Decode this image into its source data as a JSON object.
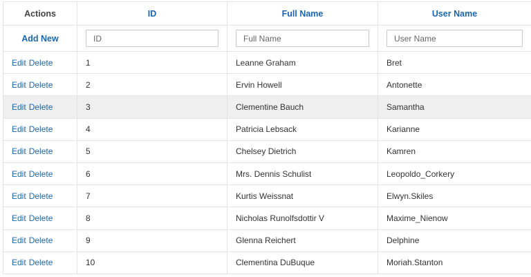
{
  "columns": {
    "actions": "Actions",
    "id": "ID",
    "full_name": "Full Name",
    "user_name": "User Name"
  },
  "filter": {
    "add_new_label": "Add New",
    "id_placeholder": "ID",
    "full_name_placeholder": "Full Name",
    "user_name_placeholder": "User Name"
  },
  "row_actions": {
    "edit_label": "Edit",
    "delete_label": "Delete"
  },
  "colors": {
    "link": "#1a66b3",
    "highlight_row": "#efefef",
    "border": "#e3e3e3"
  },
  "highlighted_row_index": 2,
  "rows": [
    {
      "id": "1",
      "full_name": "Leanne Graham",
      "user_name": "Bret"
    },
    {
      "id": "2",
      "full_name": "Ervin Howell",
      "user_name": "Antonette"
    },
    {
      "id": "3",
      "full_name": "Clementine Bauch",
      "user_name": "Samantha"
    },
    {
      "id": "4",
      "full_name": "Patricia Lebsack",
      "user_name": "Karianne"
    },
    {
      "id": "5",
      "full_name": "Chelsey Dietrich",
      "user_name": "Kamren"
    },
    {
      "id": "6",
      "full_name": "Mrs. Dennis Schulist",
      "user_name": "Leopoldo_Corkery"
    },
    {
      "id": "7",
      "full_name": "Kurtis Weissnat",
      "user_name": "Elwyn.Skiles"
    },
    {
      "id": "8",
      "full_name": "Nicholas Runolfsdottir V",
      "user_name": "Maxime_Nienow"
    },
    {
      "id": "9",
      "full_name": "Glenna Reichert",
      "user_name": "Delphine"
    },
    {
      "id": "10",
      "full_name": "Clementina DuBuque",
      "user_name": "Moriah.Stanton"
    }
  ]
}
